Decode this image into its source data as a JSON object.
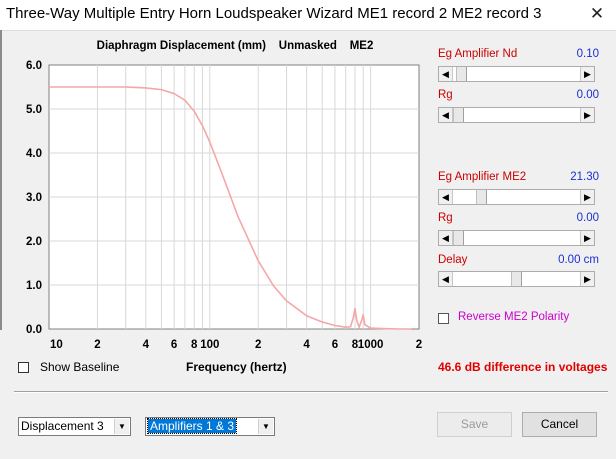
{
  "window": {
    "title": "Three-Way Multiple Entry Horn Loudspeaker Wizard    ME1 record 2    ME2 record 3",
    "close_glyph": "✕"
  },
  "chart_data": {
    "type": "line",
    "title": "Diaphragm Displacement (mm)    Unmasked    ME2",
    "xlabel": "Frequency (hertz)",
    "ylabel": "",
    "x_scale": "log",
    "xlim": [
      10,
      2000
    ],
    "ylim": [
      0,
      6
    ],
    "y_ticks": [
      "0.0",
      "1.0",
      "2.0",
      "3.0",
      "4.0",
      "5.0",
      "6.0"
    ],
    "x_ticks": [
      "10",
      "2",
      "4",
      "6",
      "8",
      "100",
      "2",
      "4",
      "6",
      "8",
      "1000",
      "2"
    ],
    "grid": true,
    "series": [
      {
        "color": "#f4a7a7",
        "x": [
          10,
          20,
          30,
          40,
          50,
          60,
          70,
          80,
          90,
          100,
          120,
          150,
          200,
          250,
          300,
          400,
          500,
          600,
          700,
          750,
          780,
          800,
          820,
          850,
          880,
          900,
          920,
          1000,
          1200,
          1500,
          1800
        ],
        "y": [
          5.5,
          5.5,
          5.5,
          5.48,
          5.44,
          5.35,
          5.2,
          4.95,
          4.62,
          4.25,
          3.5,
          2.55,
          1.55,
          0.97,
          0.64,
          0.3,
          0.16,
          0.08,
          0.04,
          0.05,
          0.25,
          0.47,
          0.2,
          0.04,
          0.2,
          0.33,
          0.1,
          0.02,
          0.01,
          0.0,
          0.0
        ]
      }
    ]
  },
  "controls": {
    "nd_group": {
      "label": "Eg  Amplifier  Nd",
      "value": "0.10",
      "slider_level": 0.03,
      "rg_label": "Rg",
      "rg_value": "0.00",
      "rg_level": 0.0
    },
    "me2_group": {
      "label": "Eg  Amplifier  ME2",
      "value": "21.30",
      "slider_level": 0.2,
      "rg_label": "Rg",
      "rg_value": "0.00",
      "rg_level": 0.0,
      "delay_label": "Delay",
      "delay_value": "0.00 cm",
      "delay_level": 0.5
    },
    "reverse_polarity_label": "Reverse ME2 Polarity",
    "reverse_polarity_checked": false,
    "show_baseline_label": "Show Baseline",
    "show_baseline_checked": false
  },
  "status": {
    "difference_text": "46.6 dB difference in voltages",
    "color": "#e00000"
  },
  "bottom": {
    "display_select": "Displacement 3",
    "amp_select": "Amplifiers 1 & 3",
    "save_label": "Save",
    "cancel_label": "Cancel"
  }
}
